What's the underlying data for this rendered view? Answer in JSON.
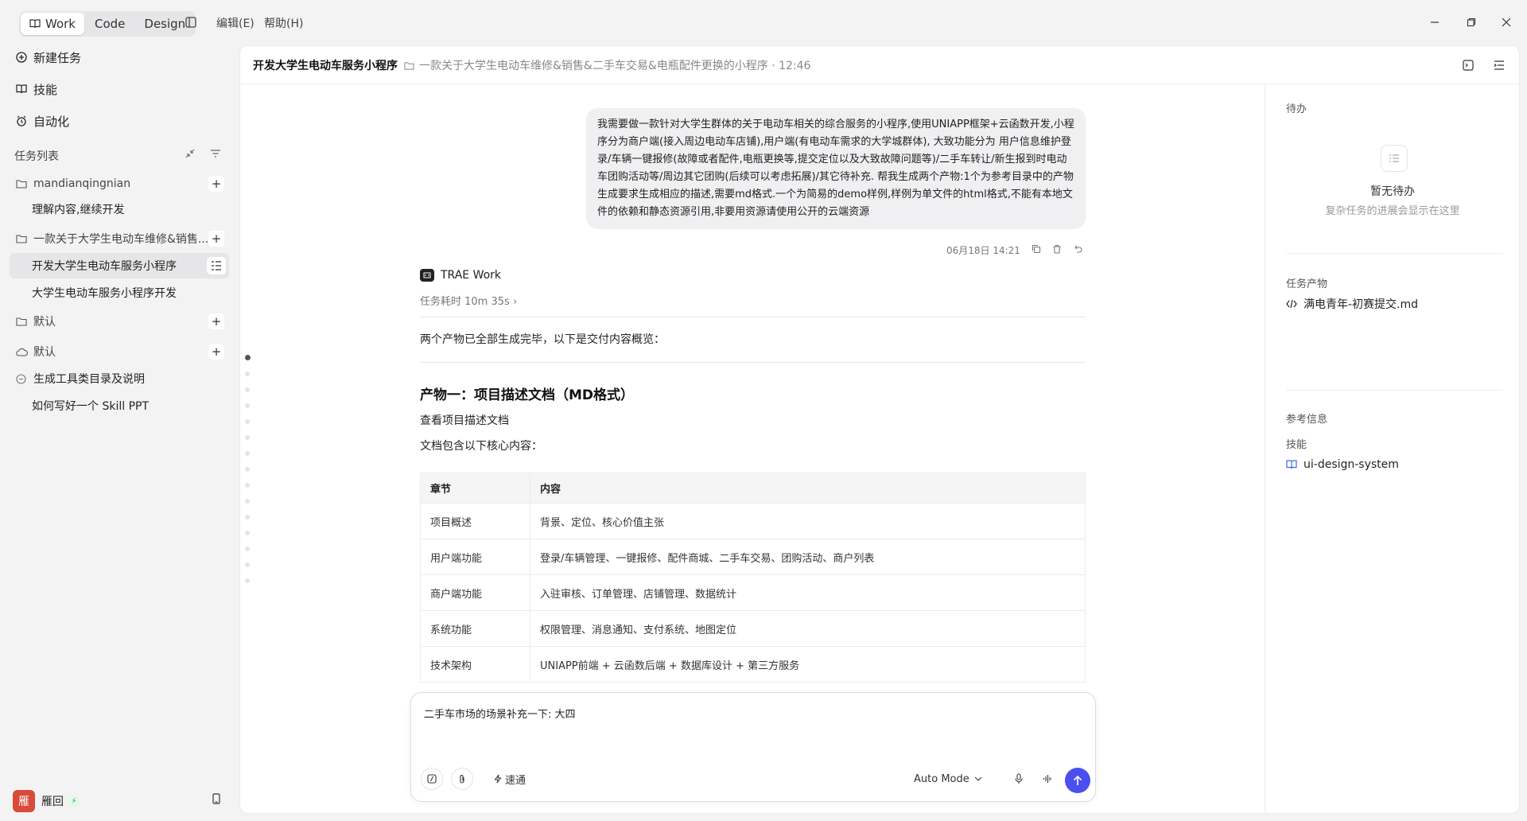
{
  "topbar": {
    "modes": [
      "Work",
      "Code",
      "Design"
    ],
    "menu": [
      "编辑(E)",
      "帮助(H)"
    ]
  },
  "sidebar": {
    "nav": [
      "新建任务",
      "技能",
      "自动化"
    ],
    "section_title": "任务列表",
    "groups": [
      {
        "label": "mandianqingnian",
        "children": [
          "理解内容,继续开发"
        ]
      },
      {
        "label": "一款关于大学生电动车维修&销售...",
        "children": [
          "开发大学生电动车服务小程序",
          "大学生电动车服务小程序开发"
        ]
      },
      {
        "label": "默认",
        "children": []
      },
      {
        "label": "默认",
        "children": []
      },
      {
        "label": "生成工具类目录及说明",
        "children": [
          "如何写好一个 Skill PPT"
        ]
      }
    ],
    "user": {
      "name": "雁回",
      "avatar_text": "雁"
    }
  },
  "header": {
    "title": "开发大学生电动车服务小程序",
    "subtitle": "一款关于大学生电动车维修&销售&二手车交易&电瓶配件更换的小程序 · 12:46"
  },
  "message": {
    "user_text": "我需要做一款针对大学生群体的关于电动车相关的综合服务的小程序,使用UNIAPP框架+云函数开发,小程序分为商户端(接入周边电动车店铺),用户端(有电动车需求的大学城群体), 大致功能分为 用户信息维护登录/车辆一键报修(故障或者配件,电瓶更换等,提交定位以及大致故障问题等)/二手车转让/新生报到时电动车团购活动等/周边其它团购(后续可以考虑拓展)/其它待补充. 帮我生成两个产物:1个为参考目录中的产物生成要求生成相应的描述,需要md格式.一个为简易的demo样例,样例为单文件的html格式,不能有本地文件的依赖和静态资源引用,非要用资源请使用公开的云端资源",
    "timestamp": "06月18日 14:21",
    "bot_name": "TRAE Work",
    "duration": "任务耗时 10m 35s",
    "summary": "两个产物已全部生成完毕，以下是交付内容概览：",
    "heading": "产物一：项目描述文档（MD格式）",
    "link_text": "查看项目描述文档",
    "intro": "文档包含以下核心内容：",
    "table": {
      "headers": [
        "章节",
        "内容"
      ],
      "rows": [
        [
          "项目概述",
          "背景、定位、核心价值主张"
        ],
        [
          "用户端功能",
          "登录/车辆管理、一键报修、配件商城、二手车交易、团购活动、商户列表"
        ],
        [
          "商户端功能",
          "入驻审核、订单管理、店铺管理、数据统计"
        ],
        [
          "系统功能",
          "权限管理、消息通知、支付系统、地图定位"
        ],
        [
          "技术架构",
          "UNIAPP前端 + 云函数后端 + 数据库设计 + 第三方服务"
        ]
      ]
    }
  },
  "composer": {
    "text": "二手车市场的场景补充一下: 大四",
    "speed_label": "速通",
    "mode_label": "Auto Mode"
  },
  "right_panel": {
    "todo_title": "待办",
    "todo_empty_title": "暂无待办",
    "todo_empty_sub": "复杂任务的进展会显示在这里",
    "artifacts_title": "任务产物",
    "artifact_file": "满电青年-初赛提交.md",
    "ref_title": "参考信息",
    "skills_title": "技能",
    "skill_name": "ui-design-system"
  },
  "colors": {
    "accent": "#4a4ff0",
    "selected_bg": "#e6e6e8"
  }
}
